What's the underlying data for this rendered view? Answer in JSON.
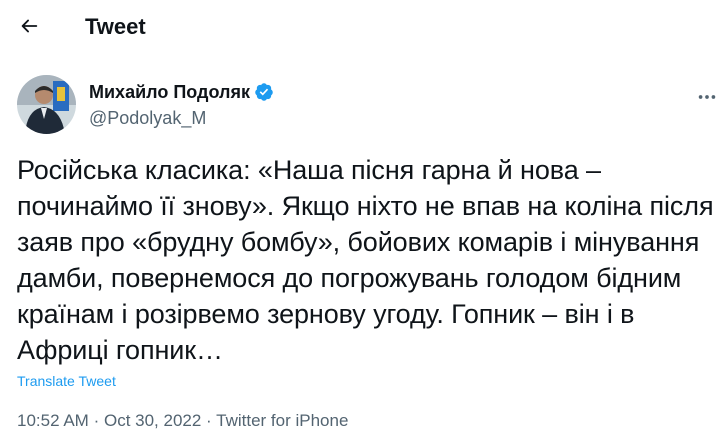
{
  "header": {
    "back_icon": "arrow-left-icon",
    "title": "Tweet"
  },
  "author": {
    "display_name": "Михайло Подоляк",
    "verified_icon": "verified-badge-icon",
    "verified_color": "#1d9bf0",
    "handle": "@Podolyak_M",
    "more_icon": "more-horizontal-icon"
  },
  "tweet": {
    "text": "Російська класика: «Наша пісня гарна й нова – починаймо її знову». Якщо ніхто не впав на коліна після заяв про «брудну бомбу», бойових комарів і мінування дамби, повернемося до погрожувань голодом бідним країнам і розірвемо зернову угоду. Гопник – він і в Африці гопник…",
    "translate_label": "Translate Tweet",
    "time": "10:52 AM",
    "date": "Oct 30, 2022",
    "separator": "·",
    "source": "Twitter for iPhone"
  },
  "colors": {
    "text": "#0f1419",
    "secondary": "#536471",
    "accent": "#1d9bf0"
  }
}
